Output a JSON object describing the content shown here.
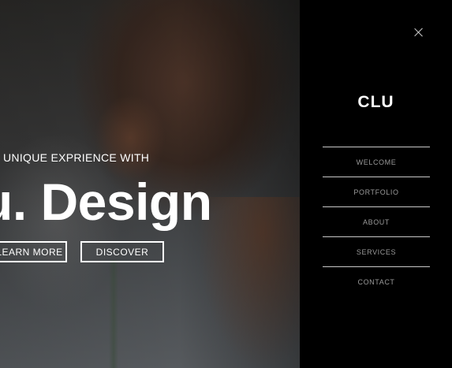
{
  "hero": {
    "tagline": "UNIQUE EXPRIENCE WITH",
    "title": "u. Design",
    "buttons": {
      "learn_more": "LEARN MORE",
      "discover": "DISCOVER"
    }
  },
  "panel": {
    "close_icon": "close-icon",
    "logo": "CLU",
    "menu": [
      {
        "label": "WELCOME"
      },
      {
        "label": "PORTFOLIO"
      },
      {
        "label": "ABOUT"
      },
      {
        "label": "SERVICES"
      },
      {
        "label": "CONTACT"
      }
    ]
  },
  "colors": {
    "panel_bg": "#000000",
    "menu_text": "#9a9a9a",
    "divider": "#c8c8c8",
    "hero_text": "#ffffff"
  }
}
